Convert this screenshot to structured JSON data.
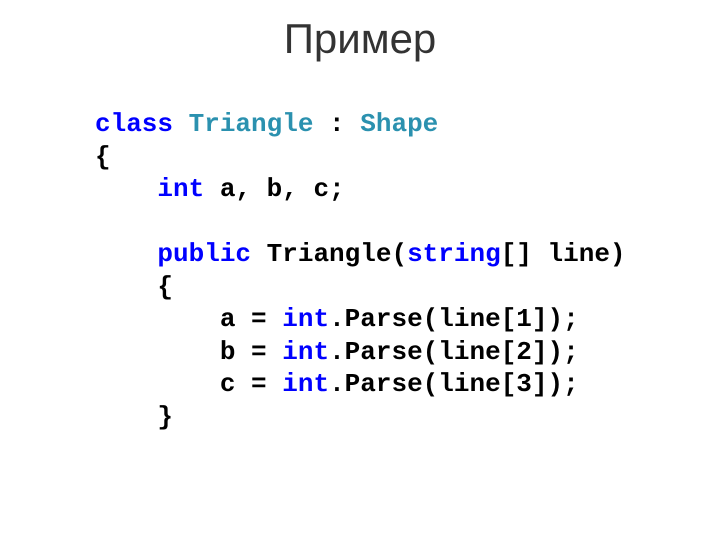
{
  "title": "Пример",
  "code": {
    "class_kw": "class",
    "triangle": "Triangle",
    "colon": " : ",
    "shape": "Shape",
    "lbrace1": "{",
    "int_kw": "int",
    "fields": " a, b, c;",
    "public_kw": "public",
    "ctor_name": " Triangle(",
    "string_kw": "string",
    "ctor_params": "[] line)",
    "lbrace2": "{",
    "a_eq": "a = ",
    "int_parse_a": "int",
    "parse_a": ".Parse(line[1]);",
    "b_eq": "b = ",
    "int_parse_b": "int",
    "parse_b": ".Parse(line[2]);",
    "c_eq": "c = ",
    "int_parse_c": "int",
    "parse_c": ".Parse(line[3]);",
    "rbrace2": "}"
  }
}
